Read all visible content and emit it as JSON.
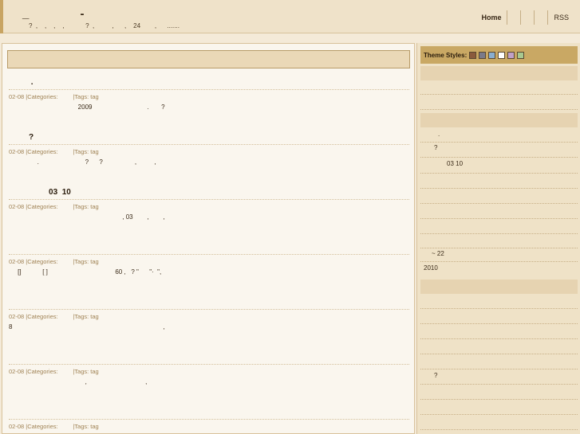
{
  "header": {
    "title": "_  -",
    "tagline": "?  ,    ,    ,    ,            ?  ,          ,      ,    24        ,      ......."
  },
  "nav": {
    "items": [
      "Home",
      "",
      "",
      "",
      "RSS"
    ]
  },
  "posts": [
    {
      "title": "          .",
      "meta": "02-08 |Categories:         |Tags: tag",
      "body": "                                       2009                               .       ?"
    },
    {
      "title": "         ?",
      "meta": "02-08 |Categories:         |Tags: tag",
      "body": "                .                          ?      ?                  ,          ,"
    },
    {
      "title": "                  03  10",
      "meta": "02-08 |Categories:         |Tags: tag",
      "body": "                                                                , 03        ,        ,"
    },
    {
      "title": "",
      "meta": "02-08 |Categories:         |Tags: tag",
      "body": "     []            [ ]                                      60 ,   ? \"      \"·  \","
    },
    {
      "title": "",
      "meta": "02-08 |Categories:         |Tags: tag",
      "body": "8                                                                                     ,"
    },
    {
      "title": "",
      "meta": "02-08 |Categories:         |Tags: tag",
      "body": "                                           ,                                 ,"
    },
    {
      "title": "",
      "meta": "02-08 |Categories:         |Tags: tag",
      "body": ""
    }
  ],
  "sidebar": {
    "theme_label": "Theme Styles:",
    "swatches": [
      "#8a5a3c",
      "#7a7a8a",
      "#8aaed0",
      "#ffffff",
      "#c0a0c8",
      "#a8c890"
    ],
    "texts": [
      ".",
      "?",
      "03 10",
      "~ 22",
      "2010",
      "?"
    ]
  }
}
